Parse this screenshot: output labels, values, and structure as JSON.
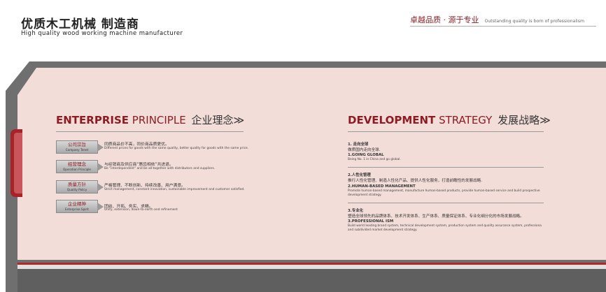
{
  "header": {
    "brand_cn": "优质木工机械 制造商",
    "brand_en": "High quality wood working machine manufacturer",
    "slogan_cn": "卓越品质 · 源于专业",
    "slogan_en": "Outstanding quality is born of professionalism"
  },
  "colors": {
    "accent": "#8d1c22",
    "panel": "#f3ddd9",
    "frame": "#6f6f6f",
    "side_tab": "#a82228"
  },
  "principle": {
    "title_word1": "ENTERPRISE",
    "title_word2": "PRINCIPLE",
    "title_cn": "企业理念≫",
    "items": [
      {
        "tag_cn": "公司宗旨",
        "tag_en": "Company Tenet",
        "desc_cn": "同质商品价不高，同价商品质更优。",
        "desc_en": "Different prices for goods with the same quality, better quality for goods with the same price."
      },
      {
        "tag_cn": "经营理念",
        "tag_en": "Operation Principle",
        "desc_cn": "与经销商及供应商“唇齿相依”共进退。",
        "desc_en": "Be \"interdependent\" and be all-together with distributors and suppliers."
      },
      {
        "tag_cn": "质量方针",
        "tag_en": "Quality Policy",
        "desc_cn": "严格管理、不断创新、持续改善、用户满意。",
        "desc_en": "Strict management, constant innovation, sustainable improvement and customer satisfied."
      },
      {
        "tag_cn": "企业精神",
        "tag_en": "Enterprise Spirit",
        "desc_cn": "团结、开拓、务实、求精。",
        "desc_en": "Unity, extension, down-to-earth and refinement"
      }
    ]
  },
  "strategy": {
    "title_word1": "DEVELOPMENT",
    "title_word2": "STRATEGY",
    "title_cn": "发展战略≫",
    "items": [
      {
        "head_cn": "1. 走向全球",
        "cn": "做质国内走向全球.",
        "head_en": "1.GOING GLOBAL",
        "en_lines": [
          "Being No. 1 in China and go global."
        ]
      },
      {
        "head_cn": "2.人性化管理",
        "cn": "推行人性化管理、制造人性化产品、提供人性化服务，打造前瞻性的发展战略.",
        "head_en": "2.HUMAN-BASED MANAGEMENT",
        "en_lines": [
          "Promote human-based management, manufacture human-based products, provide human-based service and build prospective",
          "development strategy."
        ]
      },
      {
        "head_cn": "3.专业化",
        "cn": "塑造全球领先的品牌体系、技术开发体系、生产体系、质量保证体系、专业化细分化的市场发展战略。",
        "head_en": "3.PROFESSIONAL ISM",
        "en_lines": [
          "Build world leading brand system, technical development system, production system and quality assurance system, professiona",
          "and subdivided market development strategy."
        ]
      }
    ]
  }
}
